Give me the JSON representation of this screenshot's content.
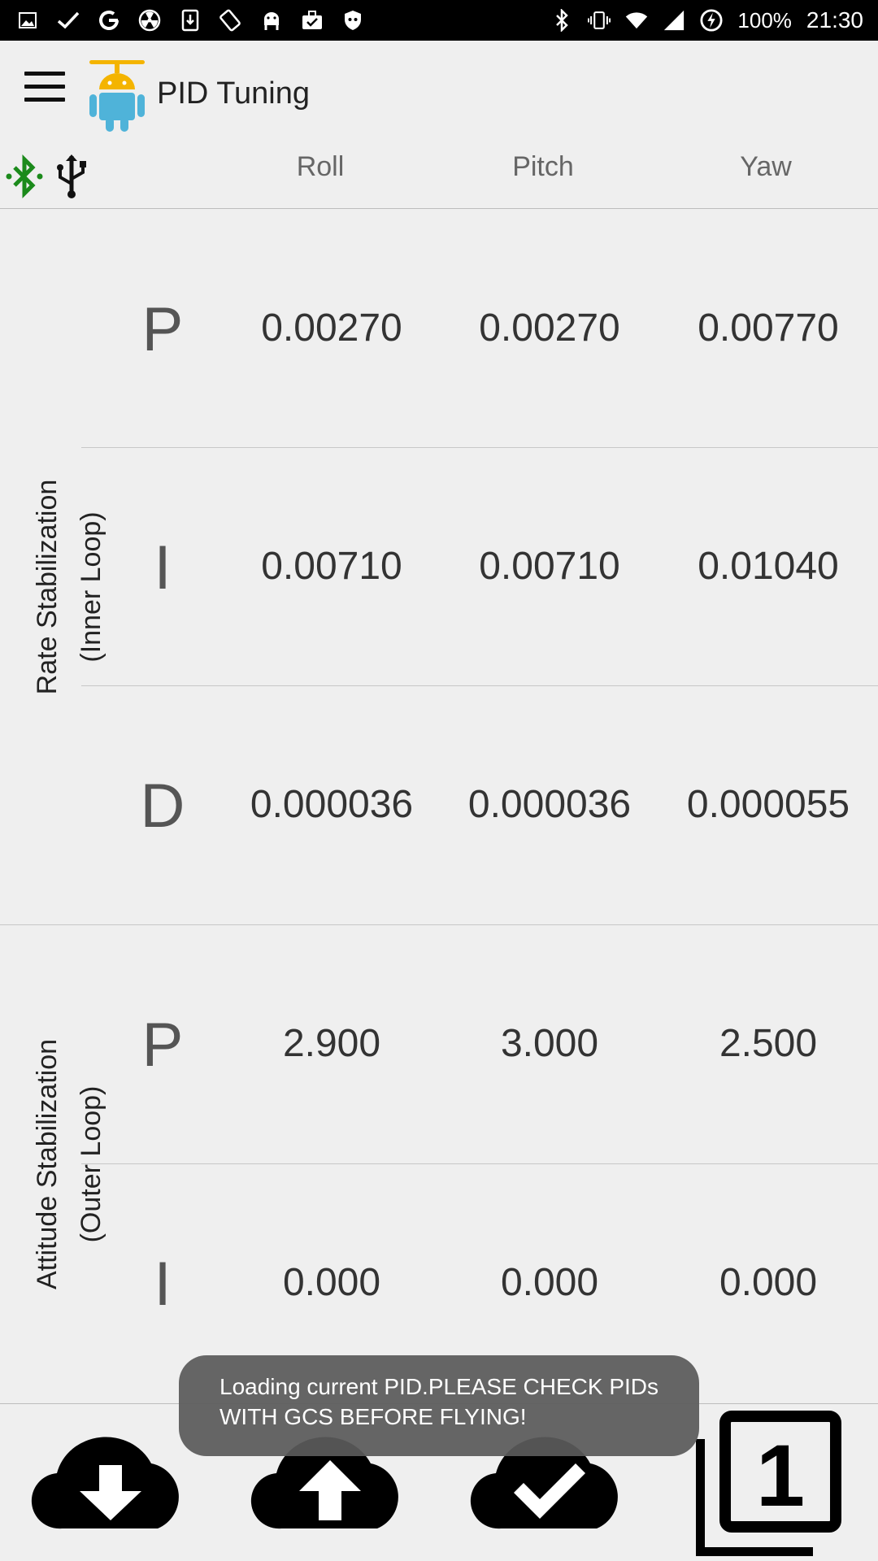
{
  "status_bar": {
    "battery": "100%",
    "time": "21:30",
    "left_icons": [
      "gallery-icon",
      "check-icon",
      "google-icon",
      "radiation-icon",
      "download-icon",
      "rotate-icon",
      "android-icon",
      "briefcase-check-icon",
      "shield-icon"
    ],
    "right_icons": [
      "bluetooth-icon",
      "vibrate-icon",
      "wifi-icon",
      "signal-icon",
      "power-saver-icon"
    ]
  },
  "app_bar": {
    "title": "PID Tuning"
  },
  "columns": [
    "Roll",
    "Pitch",
    "Yaw"
  ],
  "groups": [
    {
      "label_line1": "Rate Stabilization",
      "label_line2": "(Inner Loop)",
      "rows": [
        {
          "term": "P",
          "roll": "0.00270",
          "pitch": "0.00270",
          "yaw": "0.00770"
        },
        {
          "term": "I",
          "roll": "0.00710",
          "pitch": "0.00710",
          "yaw": "0.01040"
        },
        {
          "term": "D",
          "roll": "0.000036",
          "pitch": "0.000036",
          "yaw": "0.000055"
        }
      ]
    },
    {
      "label_line1": "Attitude Stabilization",
      "label_line2": "(Outer Loop)",
      "rows": [
        {
          "term": "P",
          "roll": "2.900",
          "pitch": "3.000",
          "yaw": "2.500"
        },
        {
          "term": "I",
          "roll": "0.000",
          "pitch": "0.000",
          "yaw": "0.000"
        }
      ]
    }
  ],
  "toast": {
    "line1": "Loading current PID.PLEASE CHECK PIDs",
    "line2": "WITH GCS BEFORE FLYING!"
  },
  "bottom_bar": {
    "buttons": [
      "cloud-download-icon",
      "cloud-upload-icon",
      "cloud-check-icon",
      "filter-1-icon"
    ],
    "page_number": "1"
  },
  "colors": {
    "bluetooth_connected": "#1b8a1b",
    "toast_bg": "#5a5a5a",
    "background": "#efefef"
  }
}
